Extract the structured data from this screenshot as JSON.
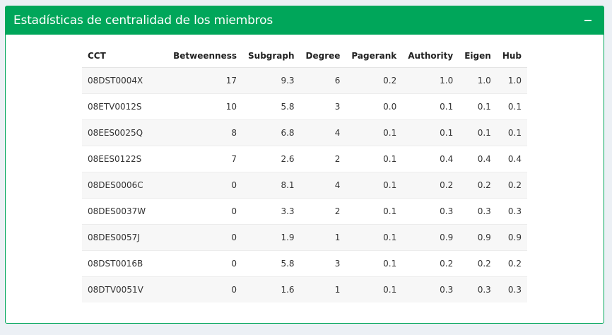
{
  "panel": {
    "title": "Estadísticas de centralidad de los miembros",
    "collapse_icon": "minus-icon"
  },
  "table": {
    "headers": [
      "CCT",
      "Betweenness",
      "Subgraph",
      "Degree",
      "Pagerank",
      "Authority",
      "Eigen",
      "Hub"
    ],
    "rows": [
      [
        "08DST0004X",
        "17",
        "9.3",
        "6",
        "0.2",
        "1.0",
        "1.0",
        "1.0"
      ],
      [
        "08ETV0012S",
        "10",
        "5.8",
        "3",
        "0.0",
        "0.1",
        "0.1",
        "0.1"
      ],
      [
        "08EES0025Q",
        "8",
        "6.8",
        "4",
        "0.1",
        "0.1",
        "0.1",
        "0.1"
      ],
      [
        "08EES0122S",
        "7",
        "2.6",
        "2",
        "0.1",
        "0.4",
        "0.4",
        "0.4"
      ],
      [
        "08DES0006C",
        "0",
        "8.1",
        "4",
        "0.1",
        "0.2",
        "0.2",
        "0.2"
      ],
      [
        "08DES0037W",
        "0",
        "3.3",
        "2",
        "0.1",
        "0.3",
        "0.3",
        "0.3"
      ],
      [
        "08DES0057J",
        "0",
        "1.9",
        "1",
        "0.1",
        "0.9",
        "0.9",
        "0.9"
      ],
      [
        "08DST0016B",
        "0",
        "5.8",
        "3",
        "0.1",
        "0.2",
        "0.2",
        "0.2"
      ],
      [
        "08DTV0051V",
        "0",
        "1.6",
        "1",
        "0.1",
        "0.3",
        "0.3",
        "0.3"
      ]
    ]
  },
  "colors": {
    "header_bg": "#00a65a",
    "page_bg": "#ecf0f5",
    "stripe": "#f7f7f7"
  }
}
